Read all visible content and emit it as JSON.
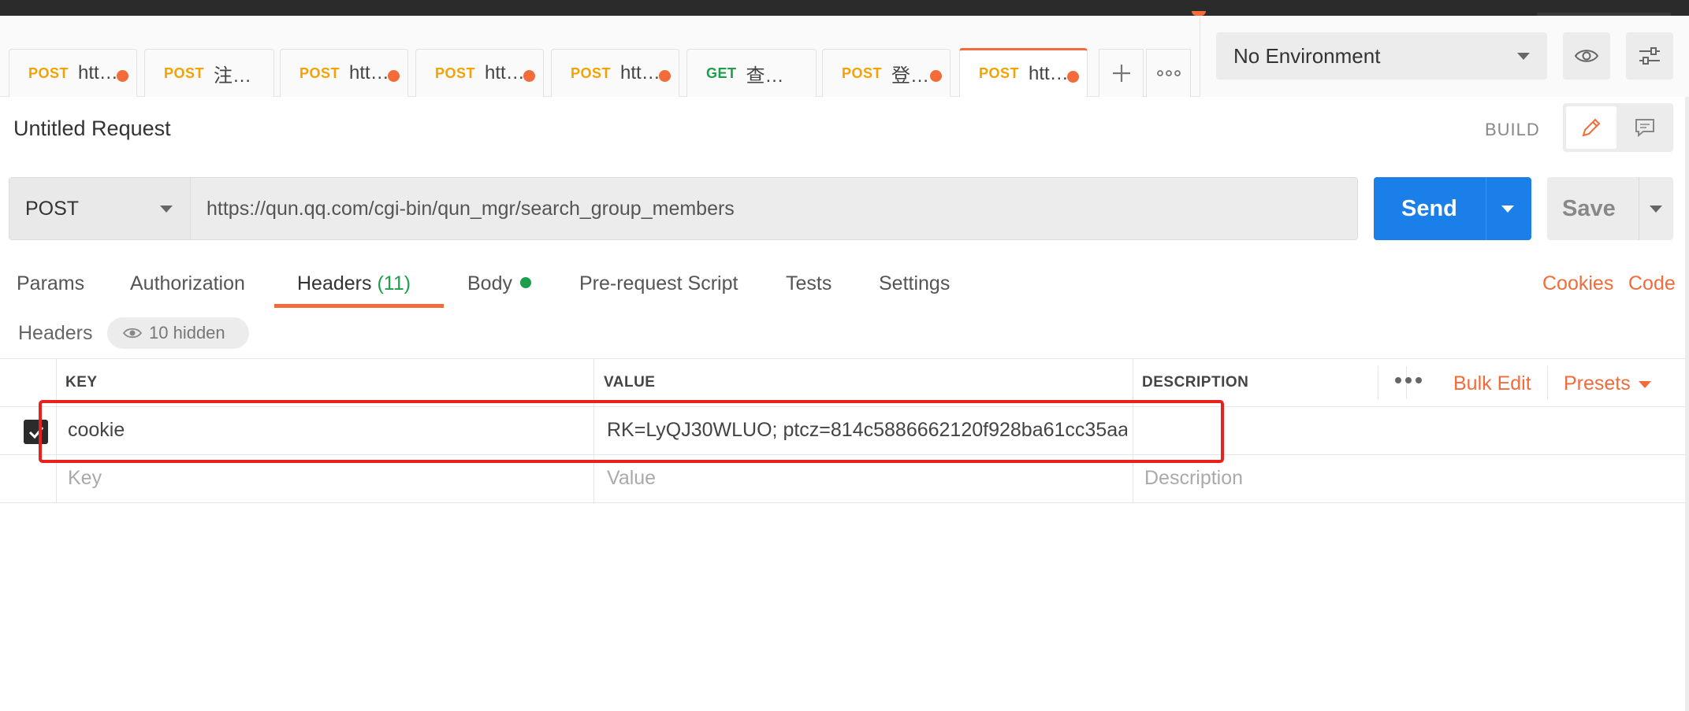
{
  "tabs": [
    {
      "method": "POST",
      "name": "htt…",
      "unsaved": true
    },
    {
      "method": "POST",
      "name": "注…",
      "unsaved": false
    },
    {
      "method": "POST",
      "name": "htt…",
      "unsaved": true
    },
    {
      "method": "POST",
      "name": "htt…",
      "unsaved": true
    },
    {
      "method": "POST",
      "name": "htt…",
      "unsaved": true
    },
    {
      "method": "GET",
      "name": "查…",
      "unsaved": false
    },
    {
      "method": "POST",
      "name": "登…",
      "unsaved": true
    },
    {
      "method": "POST",
      "name": "htt…",
      "unsaved": true,
      "active": true
    }
  ],
  "tab_actions": {
    "new_tab_icon": "plus-icon",
    "more_icon": "more-horizontal-icon"
  },
  "environment": {
    "selected": "No Environment",
    "eye_icon": "eye-icon",
    "settings_icon": "sliders-icon"
  },
  "request": {
    "title": "Untitled Request",
    "mode_label": "BUILD",
    "method": "POST",
    "url": "https://qun.qq.com/cgi-bin/qun_mgr/search_group_members",
    "send_label": "Send",
    "save_label": "Save"
  },
  "subtabs": {
    "params": "Params",
    "authorization": "Authorization",
    "headers": "Headers",
    "headers_count": "(11)",
    "body": "Body",
    "prerequest": "Pre-request Script",
    "tests": "Tests",
    "settings": "Settings",
    "cookies": "Cookies",
    "code": "Code"
  },
  "headers_section": {
    "label": "Headers",
    "hidden": "10 hidden"
  },
  "table": {
    "columns": {
      "key": "KEY",
      "value": "VALUE",
      "description": "DESCRIPTION"
    },
    "bulk_edit": "Bulk Edit",
    "presets": "Presets",
    "rows": [
      {
        "key": "cookie",
        "value": "RK=LyQJ30WLUO; ptcz=814c5886662120f928ba61cc35aa...",
        "description": "",
        "enabled": true
      }
    ],
    "placeholders": {
      "key": "Key",
      "value": "Value",
      "description": "Description"
    }
  },
  "colors": {
    "accent": "#f26b3a",
    "send": "#1a7fe8",
    "highlight": "#e8221a",
    "post": "#f4a200",
    "get": "#1c9e4a"
  }
}
